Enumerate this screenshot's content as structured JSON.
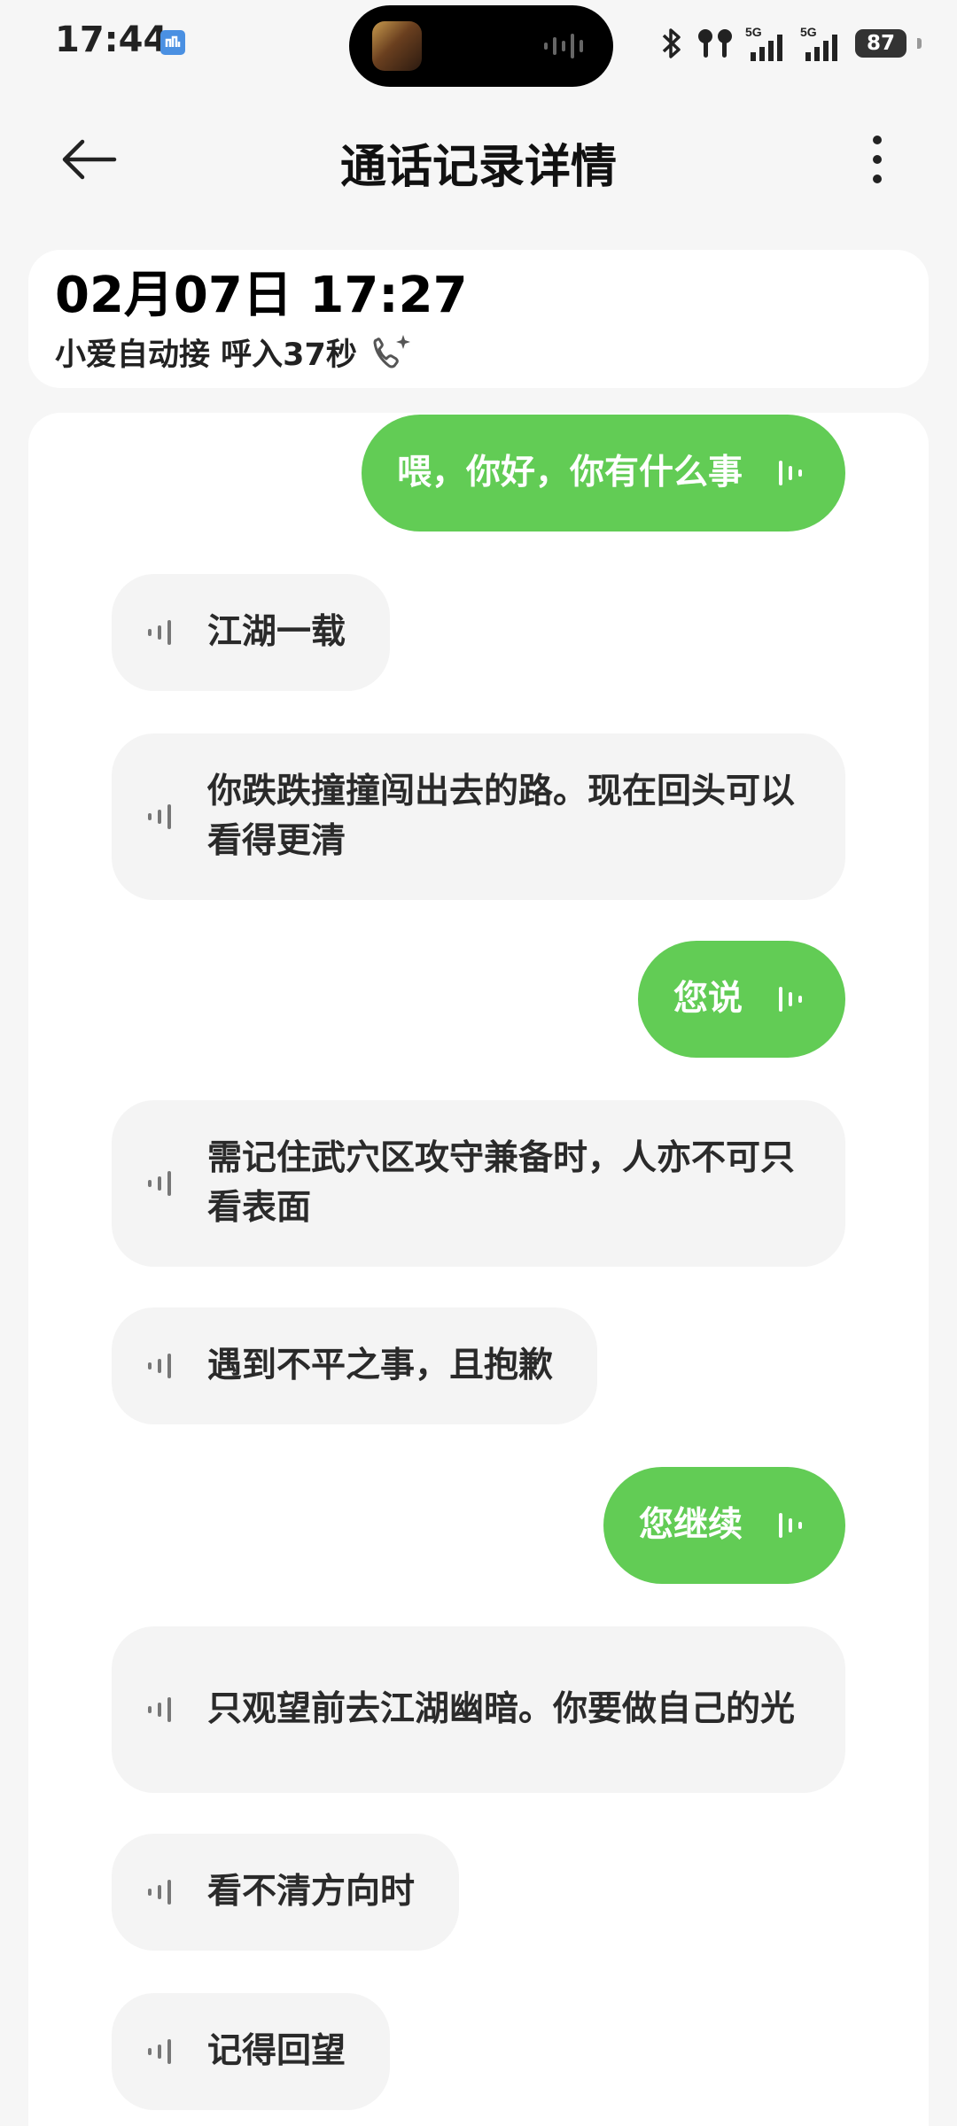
{
  "status_bar": {
    "time": "17:44",
    "battery": "87",
    "icons": [
      "notification-icon",
      "bluetooth-icon",
      "earbuds-icon",
      "signal-5g-sim1-icon",
      "signal-5g-sim2-icon",
      "battery-icon"
    ]
  },
  "header": {
    "title": "通话记录详情",
    "back_icon": "back-arrow-icon",
    "more_icon": "more-vertical-icon"
  },
  "call_info": {
    "datetime": "02月07日 17:27",
    "meta": "小爱自动接 呼入37秒",
    "icon": "ai-call-icon"
  },
  "colors": {
    "outgoing_bubble": "#62cc55",
    "incoming_bubble": "#f4f4f4",
    "background": "#f6f6f6"
  },
  "transcript": [
    {
      "speaker": "self",
      "text": "喂，你好，你有什么事"
    },
    {
      "speaker": "caller",
      "text": "江湖一载"
    },
    {
      "speaker": "caller",
      "text": "你跌跌撞撞闯出去的路。现在回头可以看得更清"
    },
    {
      "speaker": "self",
      "text": "您说"
    },
    {
      "speaker": "caller",
      "text": "需记住武穴区攻守兼备时，人亦不可只看表面"
    },
    {
      "speaker": "caller",
      "text": "遇到不平之事，且抱歉"
    },
    {
      "speaker": "self",
      "text": "您继续"
    },
    {
      "speaker": "caller",
      "text": "只观望前去江湖幽暗。你要做自己的光"
    },
    {
      "speaker": "caller",
      "text": "看不清方向时"
    },
    {
      "speaker": "caller",
      "text": "记得回望"
    }
  ]
}
